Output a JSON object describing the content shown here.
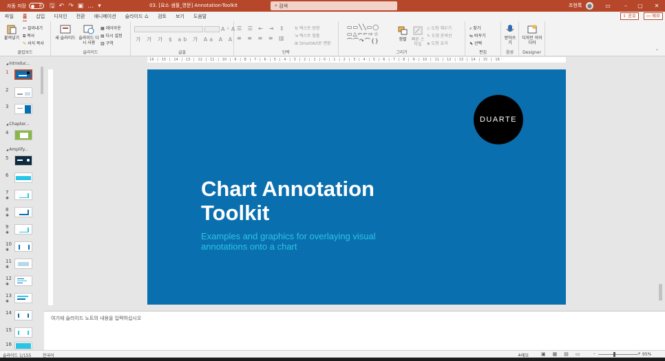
{
  "app": {
    "autosave_label": "자동 저장",
    "autosave_state": "끔",
    "document_title": "03. [요소 샘플_영문] Annotation-Toolkit",
    "search_placeholder": "검색",
    "user_name": "조현록",
    "accent_color": "#b7472a"
  },
  "tabs": [
    "파일",
    "홈",
    "삽입",
    "디자인",
    "전환",
    "애니메이션",
    "슬라이드 쇼",
    "검토",
    "보기",
    "도움말"
  ],
  "active_tab": "홈",
  "share_label": "공유",
  "memo_label": "메모",
  "ribbon": {
    "clipboard": {
      "label": "클립보드",
      "paste": "붙여넣기",
      "cut": "잘라내기",
      "copy": "복사",
      "format_painter": "서식 복사"
    },
    "slides": {
      "label": "슬라이드",
      "new_slide": "새 슬라이드",
      "reuse_slide": "슬라이드 다시 사용",
      "layout": "레이아웃",
      "reset": "다시 설정",
      "section": "구역"
    },
    "font": {
      "label": "글꼴"
    },
    "paragraph": {
      "label": "단락",
      "text_direction": "텍스트 방향",
      "align_text": "텍스트 맞춤",
      "smartart": "SmartArt로 변환"
    },
    "drawing": {
      "label": "그리기",
      "arrange": "정렬",
      "quick_styles": "빠른 스타일",
      "shape_fill": "도형 채우기",
      "shape_outline": "도형 윤곽선",
      "shape_effects": "도형 효과"
    },
    "editing": {
      "label": "편집",
      "find": "찾기",
      "replace": "바꾸기",
      "select": "선택"
    },
    "voice": {
      "label": "음성",
      "dictate": "받아쓰기"
    },
    "designer": {
      "label": "Designer",
      "design_ideas": "디자인 아이디어"
    }
  },
  "ruler_text": "· 16 · | · 15 · | · 14 · | · 13 · | · 12 · | · 11 · | · 10 · | · 9 · | · 8 · | · 7 · | · 6 · | · 5 · | · 4 · | · 3 · | · 2 · | · 1 · | · 0 · | · 1 · | · 2 · | · 3 · | · 4 · | · 5 · | · 6 · | · 7 · | · 8 · | · 9 · | · 10 · | · 11 · | · 12 · | · 13 · | · 14 · | · 15 · | · 16 ·",
  "sections": [
    "Introduc...",
    "Chapter...",
    "Amplify..."
  ],
  "slide_numbers": [
    "1",
    "2",
    "3",
    "4",
    "5",
    "6",
    "7",
    "8",
    "9",
    "10",
    "11",
    "12",
    "13",
    "14",
    "15",
    "16"
  ],
  "slide": {
    "logo_text": "DUARTE",
    "title": "Chart Annotation Toolkit",
    "subtitle": "Examples and graphics for overlaying visual annotations onto a chart",
    "background_color": "#0a6fae",
    "subtitle_color": "#29c5e6"
  },
  "notes_placeholder": "여기에 슬라이드 노트의 내용을 입력하십시오",
  "status": {
    "slide_count": "슬라이드 1/155",
    "language": "한국어",
    "notes": "메모",
    "zoom": "95%"
  }
}
